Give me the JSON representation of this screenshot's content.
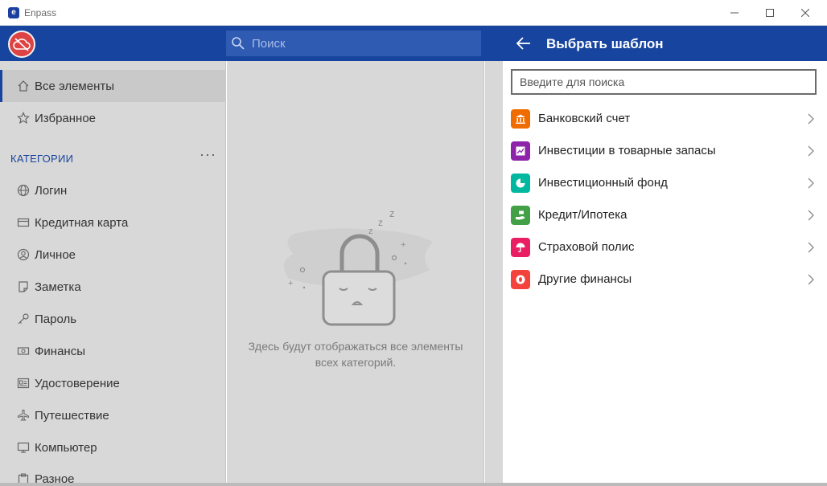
{
  "window": {
    "title": "Enpass",
    "logo_glyph": "e"
  },
  "header": {
    "search_placeholder": "Поиск"
  },
  "sidebar": {
    "items_top": [
      {
        "label": "Все элементы",
        "icon": "home-icon"
      },
      {
        "label": "Избранное",
        "icon": "star-icon"
      }
    ],
    "categories_header": "КАТЕГОРИИ",
    "categories_menu": "···",
    "categories": [
      {
        "label": "Логин",
        "icon": "globe-icon"
      },
      {
        "label": "Кредитная карта",
        "icon": "credit-card-icon"
      },
      {
        "label": "Личное",
        "icon": "person-icon"
      },
      {
        "label": "Заметка",
        "icon": "note-icon"
      },
      {
        "label": "Пароль",
        "icon": "key-icon"
      },
      {
        "label": "Финансы",
        "icon": "money-icon"
      },
      {
        "label": "Удостоверение",
        "icon": "id-card-icon"
      },
      {
        "label": "Путешествие",
        "icon": "plane-icon"
      },
      {
        "label": "Компьютер",
        "icon": "computer-icon"
      },
      {
        "label": "Разное",
        "icon": "clipboard-icon"
      }
    ]
  },
  "list": {
    "empty_line1": "Здесь будут отображаться все элементы",
    "empty_line2": "всех категорий."
  },
  "panel": {
    "title": "Выбрать шаблон",
    "search_placeholder": "Введите для поиска",
    "templates": [
      {
        "label": "Банковский счет",
        "icon": "bank-icon",
        "color": "#ef6c00"
      },
      {
        "label": "Инвестиции в товарные запасы",
        "icon": "chart-icon",
        "color": "#8e24aa"
      },
      {
        "label": "Инвестиционный фонд",
        "icon": "pie-icon",
        "color": "#00b89f"
      },
      {
        "label": "Кредит/Ипотека",
        "icon": "loan-icon",
        "color": "#43a047"
      },
      {
        "label": "Страховой полис",
        "icon": "umbrella-icon",
        "color": "#e91e63"
      },
      {
        "label": "Другие финансы",
        "icon": "coin-icon",
        "color": "#f4433c"
      }
    ]
  },
  "colors": {
    "brand_blue": "#17449e",
    "avatar_red": "#de4343"
  }
}
